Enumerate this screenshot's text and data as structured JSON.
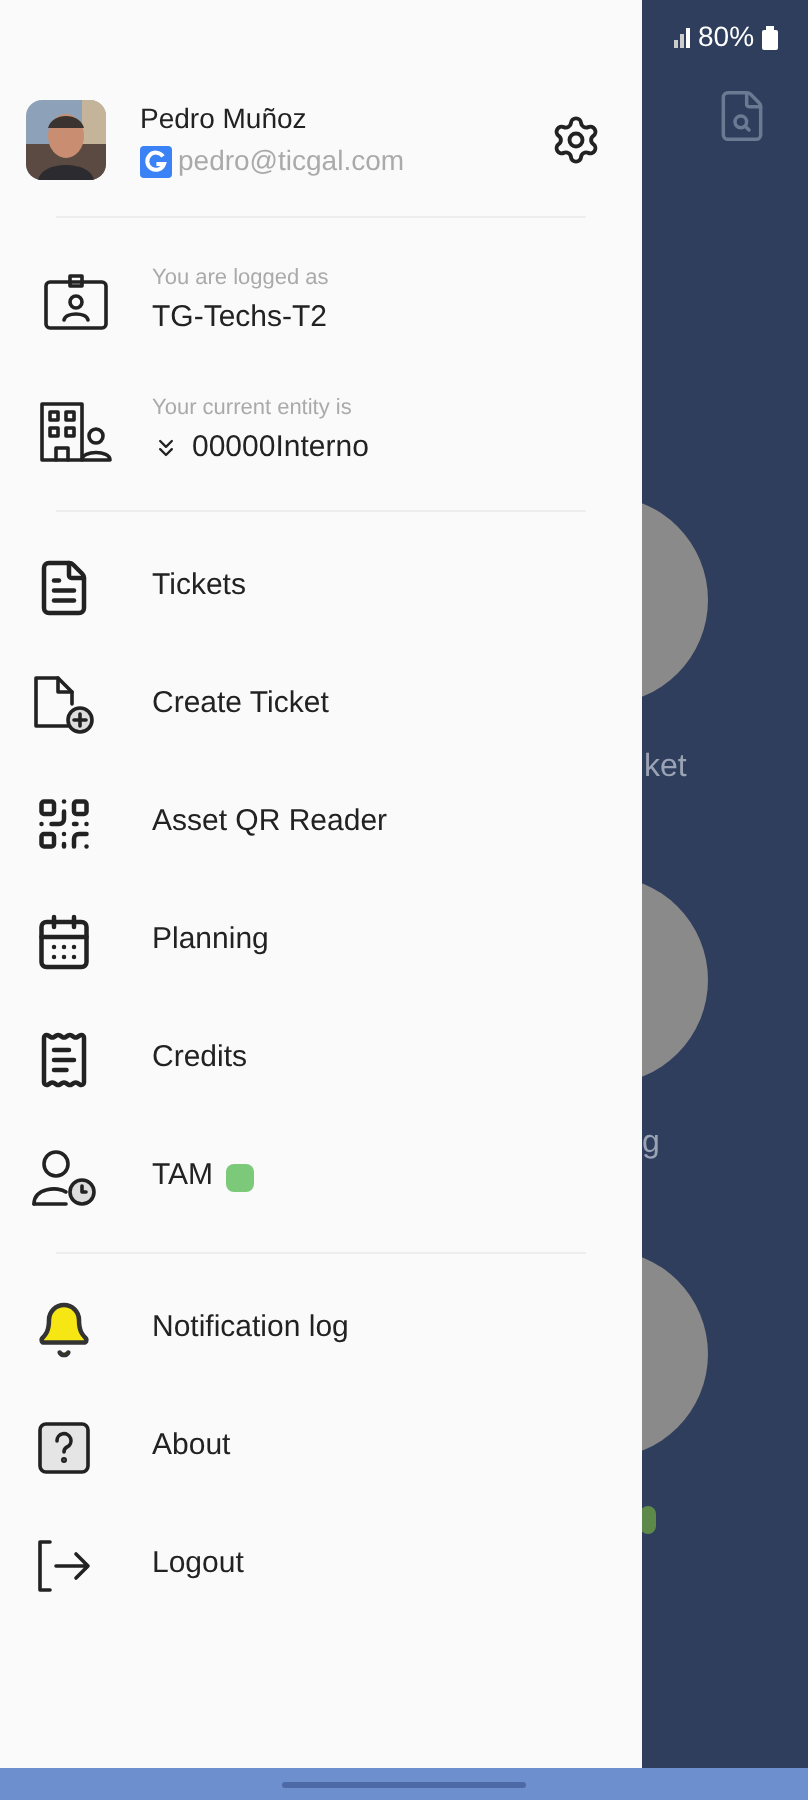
{
  "status_bar": {
    "battery": "80%"
  },
  "background": {
    "labels": [
      "ket",
      "g"
    ]
  },
  "drawer": {
    "user": {
      "name": "Pedro Muñoz",
      "email": "pedro@ticgal.com"
    },
    "session": [
      {
        "caption": "You are logged as",
        "value": "TG-Techs-T2",
        "kind": "plain"
      },
      {
        "caption": "Your current entity is",
        "value": "00000Interno",
        "kind": "dropdown"
      }
    ],
    "sections": [
      {
        "items": [
          {
            "label": "Tickets"
          },
          {
            "label": "Create Ticket"
          },
          {
            "label": "Asset QR Reader"
          },
          {
            "label": "Planning"
          },
          {
            "label": "Credits"
          },
          {
            "label": "TAM",
            "color": "#7cc97a"
          }
        ]
      },
      {
        "items": [
          {
            "label": "Notification log"
          },
          {
            "label": "About"
          },
          {
            "label": "Logout"
          }
        ]
      }
    ]
  }
}
